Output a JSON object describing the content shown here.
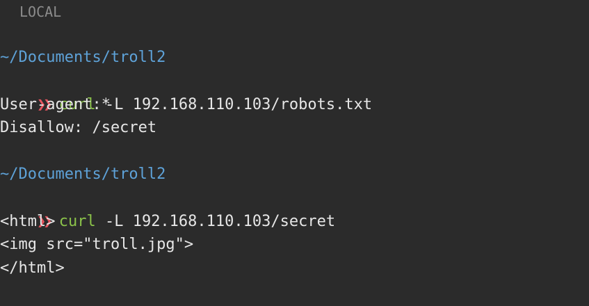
{
  "header": {
    "label": "LOCAL"
  },
  "blocks": [
    {
      "path": "~/Documents/troll2",
      "prompt": "❯❯",
      "command": "curl",
      "args": " -L 192.168.110.103/robots.txt",
      "output": [
        "User-agent:*",
        "Disallow: /secret"
      ]
    },
    {
      "path": "~/Documents/troll2",
      "prompt": "❯❯",
      "command": "curl",
      "args": " -L 192.168.110.103/secret",
      "output": [
        "<html>",
        "<img src=\"troll.jpg\">",
        "</html>"
      ]
    }
  ],
  "colors": {
    "background": "#2b2b2b",
    "path": "#5ea2d8",
    "prompt": "#e8555f",
    "command": "#8bc34a",
    "text": "#e6e6e6"
  }
}
